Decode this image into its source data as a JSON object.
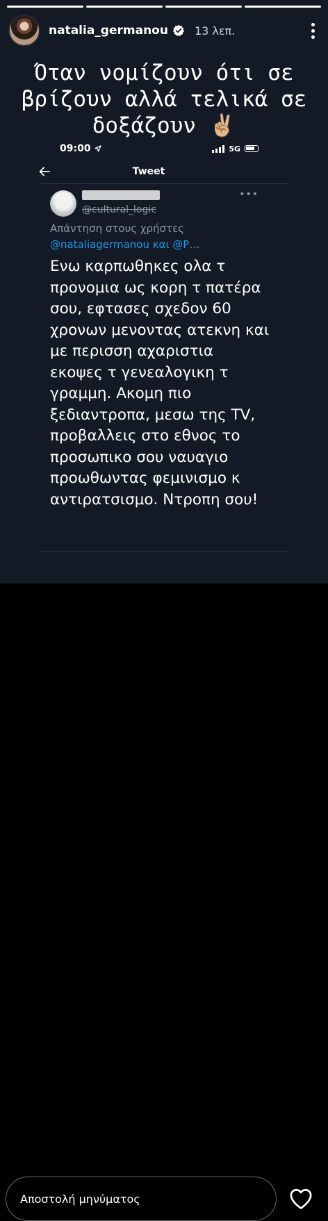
{
  "story": {
    "progress_segments": 4,
    "active_segment": 4,
    "header": {
      "username": "natalia_germanou",
      "verified": true,
      "timestamp": "13 λεπ.",
      "menu_icon": "more-vertical-icon"
    },
    "caption": "Όταν νομίζουν ότι σε βρίζουν αλλά τελικά σε δοξάζουν ✌🏼"
  },
  "screenshot": {
    "status_bar": {
      "time": "09:00",
      "network": "5G"
    },
    "top_bar": {
      "title": "Tweet",
      "back_icon": "arrow-left-icon"
    },
    "tweet": {
      "handle": "@cultural_logic",
      "reply_label": "Απάντηση στους χρήστες",
      "mentions": "@nataliagermanou και @P…",
      "text": "Ενω καρπωθηκες ολα τ προνομια ως κορη τ πατέρα σου, εφτασες σχεδον 60 χρονων μενοντας ατεκνη και με περισση αχαριστια εκοψες τ γενεαλογικη τ γραμμη. Ακομη πιο ξεδιαντροπα, μεσω της TV, προβαλλεις στο εθνος το προσωπικο σου ναυαγιο προωθωντας φεμινισμο κ αντιρατσισμο. Ντροπη σου!",
      "more_icon": "more-horizontal-icon"
    }
  },
  "footer": {
    "message_placeholder": "Αποστολή μηνύματος",
    "like_icon": "heart-outline-icon"
  },
  "colors": {
    "story_bg": "#131a25",
    "link": "#1d9bf0",
    "muted": "#8b98a5"
  }
}
